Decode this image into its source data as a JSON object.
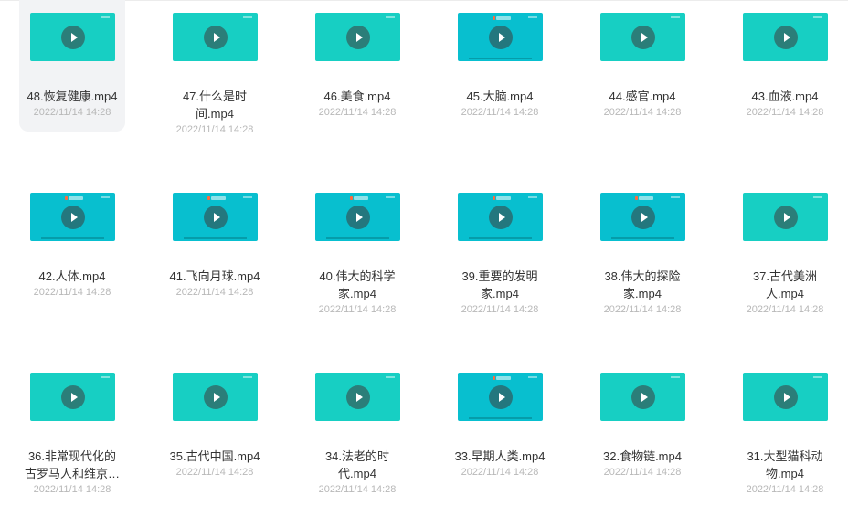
{
  "colors": {
    "thumb_teal": "#17cfc3",
    "thumb_cyan": "#08bfcf",
    "selected_bg": "#f2f3f5"
  },
  "icons": {
    "play": "play-icon",
    "more": "more-options-icon",
    "select": "select-checkbox"
  },
  "files": [
    {
      "name": "48.恢复健康.mp4",
      "date": "2022/11/14 14:28",
      "tone": "teal",
      "selected": true
    },
    {
      "name": "47.什么是时间.mp4",
      "date": "2022/11/14 14:28",
      "tone": "teal"
    },
    {
      "name": "46.美食.mp4",
      "date": "2022/11/14 14:28",
      "tone": "teal"
    },
    {
      "name": "45.大脑.mp4",
      "date": "2022/11/14 14:28",
      "tone": "cyan"
    },
    {
      "name": "44.感官.mp4",
      "date": "2022/11/14 14:28",
      "tone": "teal"
    },
    {
      "name": "43.血液.mp4",
      "date": "2022/11/14 14:28",
      "tone": "teal"
    },
    {
      "name": "42.人体.mp4",
      "date": "2022/11/14 14:28",
      "tone": "cyan"
    },
    {
      "name": "41.飞向月球.mp4",
      "date": "2022/11/14 14:28",
      "tone": "cyan"
    },
    {
      "name": "40.伟大的科学家.mp4",
      "date": "2022/11/14 14:28",
      "tone": "cyan"
    },
    {
      "name": "39.重要的发明家.mp4",
      "date": "2022/11/14 14:28",
      "tone": "cyan"
    },
    {
      "name": "38.伟大的探险家.mp4",
      "date": "2022/11/14 14:28",
      "tone": "cyan"
    },
    {
      "name": "37.古代美洲人.mp4",
      "date": "2022/11/14 14:28",
      "tone": "teal"
    },
    {
      "name": "36.非常现代化的古罗马人和维京…",
      "date": "2022/11/14 14:28",
      "tone": "teal"
    },
    {
      "name": "35.古代中国.mp4",
      "date": "2022/11/14 14:28",
      "tone": "teal"
    },
    {
      "name": "34.法老的时代.mp4",
      "date": "2022/11/14 14:28",
      "tone": "teal"
    },
    {
      "name": "33.早期人类.mp4",
      "date": "2022/11/14 14:28",
      "tone": "cyan"
    },
    {
      "name": "32.食物链.mp4",
      "date": "2022/11/14 14:28",
      "tone": "teal"
    },
    {
      "name": "31.大型猫科动物.mp4",
      "date": "2022/11/14 14:28",
      "tone": "teal"
    }
  ]
}
